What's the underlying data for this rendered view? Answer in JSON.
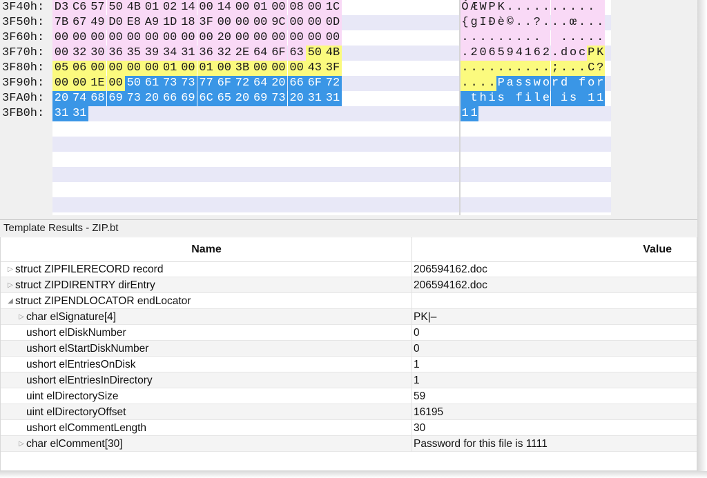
{
  "hex_view": {
    "addresses": [
      "3F40h:",
      "3F50h:",
      "3F60h:",
      "3F70h:",
      "3F80h:",
      "3F90h:",
      "3FA0h:",
      "3FB0h:"
    ],
    "rows": [
      {
        "bytes": [
          "D3",
          "C6",
          "57",
          "50",
          "4B",
          "01",
          "02",
          "14",
          "00",
          "14",
          "00",
          "01",
          "00",
          "08",
          "00",
          "1C"
        ],
        "text": "ÓÆWPK..........",
        "hl": [
          "pink",
          "pink",
          "pink",
          "pink",
          "pink",
          "pink",
          "pink",
          "pink",
          "pink",
          "pink",
          "pink",
          "pink",
          "pink",
          "pink",
          "pink",
          "pink"
        ]
      },
      {
        "bytes": [
          "7B",
          "67",
          "49",
          "D0",
          "E8",
          "A9",
          "1D",
          "18",
          "3F",
          "00",
          "00",
          "00",
          "9C",
          "00",
          "00",
          "0D"
        ],
        "text": "{gIÐè©..?...œ...",
        "hl": [
          "pink",
          "pink",
          "pink",
          "pink",
          "pink",
          "pink",
          "pink",
          "pink",
          "pink",
          "pink",
          "pink",
          "pink",
          "pink",
          "pink",
          "pink",
          "pink"
        ]
      },
      {
        "bytes": [
          "00",
          "00",
          "00",
          "00",
          "00",
          "00",
          "00",
          "00",
          "00",
          "20",
          "00",
          "00",
          "00",
          "00",
          "00",
          "00"
        ],
        "text": ".........  .....",
        "hl": [
          "pink",
          "pink",
          "pink",
          "pink",
          "pink",
          "pink",
          "pink",
          "pink",
          "pink",
          "pink",
          "pink",
          "pink",
          "pink",
          "pink",
          "pink",
          "pink"
        ]
      },
      {
        "bytes": [
          "00",
          "32",
          "30",
          "36",
          "35",
          "39",
          "34",
          "31",
          "36",
          "32",
          "2E",
          "64",
          "6F",
          "63",
          "50",
          "4B"
        ],
        "text": ".206594162.docPK",
        "hl": [
          "pink",
          "pink",
          "pink",
          "pink",
          "pink",
          "pink",
          "pink",
          "pink",
          "pink",
          "pink",
          "pink",
          "pink",
          "pink",
          "pink",
          "yellow",
          "yellow"
        ]
      },
      {
        "bytes": [
          "05",
          "06",
          "00",
          "00",
          "00",
          "00",
          "01",
          "00",
          "01",
          "00",
          "3B",
          "00",
          "00",
          "00",
          "43",
          "3F"
        ],
        "text": "..........;...C?",
        "hl": [
          "yellow",
          "yellow",
          "yellow",
          "yellow",
          "yellow",
          "yellow",
          "yellow",
          "yellow",
          "yellow",
          "yellow",
          "yellow",
          "yellow",
          "yellow",
          "yellow",
          "yellow",
          "yellow"
        ]
      },
      {
        "bytes": [
          "00",
          "00",
          "1E",
          "00",
          "50",
          "61",
          "73",
          "73",
          "77",
          "6F",
          "72",
          "64",
          "20",
          "66",
          "6F",
          "72"
        ],
        "text": "....Password for",
        "hl": [
          "yellow",
          "yellow",
          "yellow",
          "yellow",
          "blue",
          "blue",
          "blue",
          "blue",
          "blue",
          "blue",
          "blue",
          "blue",
          "blue",
          "blue",
          "blue",
          "blue"
        ]
      },
      {
        "bytes": [
          "20",
          "74",
          "68",
          "69",
          "73",
          "20",
          "66",
          "69",
          "6C",
          "65",
          "20",
          "69",
          "73",
          "20",
          "31",
          "31"
        ],
        "text": " this file is 11",
        "hl": [
          "blue",
          "blue",
          "blue",
          "blue",
          "blue",
          "blue",
          "blue",
          "blue",
          "blue",
          "blue",
          "blue",
          "blue",
          "blue",
          "blue",
          "blue",
          "blue"
        ]
      },
      {
        "bytes": [
          "31",
          "31"
        ],
        "text": "11",
        "hl": [
          "blue",
          "blue"
        ]
      }
    ],
    "colors": {
      "pink": "#f9d9f6",
      "yellow": "#fbfa7e",
      "blue": "#3a96e6"
    }
  },
  "results": {
    "title": "Template Results - ZIP.bt",
    "col_name": "Name",
    "col_value": "Value",
    "rows": [
      {
        "name": "struct ZIPFILERECORD record",
        "value": "206594162.doc",
        "toggle": "collapsed",
        "indent": 0
      },
      {
        "name": "struct ZIPDIRENTRY dirEntry",
        "value": "206594162.doc",
        "toggle": "collapsed",
        "indent": 0
      },
      {
        "name": "struct ZIPENDLOCATOR endLocator",
        "value": "",
        "toggle": "expanded",
        "indent": 0
      },
      {
        "name": "char elSignature[4]",
        "value": "PK|–",
        "toggle": "collapsed",
        "indent": 1
      },
      {
        "name": "ushort elDiskNumber",
        "value": "0",
        "toggle": "none",
        "indent": 1
      },
      {
        "name": "ushort elStartDiskNumber",
        "value": "0",
        "toggle": "none",
        "indent": 1
      },
      {
        "name": "ushort elEntriesOnDisk",
        "value": "1",
        "toggle": "none",
        "indent": 1
      },
      {
        "name": "ushort elEntriesInDirectory",
        "value": "1",
        "toggle": "none",
        "indent": 1
      },
      {
        "name": "uint elDirectorySize",
        "value": "59",
        "toggle": "none",
        "indent": 1
      },
      {
        "name": "uint elDirectoryOffset",
        "value": "16195",
        "toggle": "none",
        "indent": 1
      },
      {
        "name": "ushort elCommentLength",
        "value": "30",
        "toggle": "none",
        "indent": 1
      },
      {
        "name": "char elComment[30]",
        "value": "Password for this file is 1111",
        "toggle": "collapsed",
        "indent": 1
      }
    ]
  }
}
